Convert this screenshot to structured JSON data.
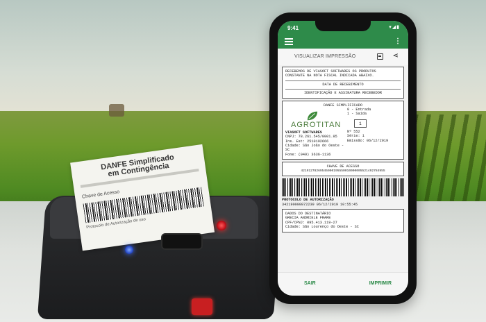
{
  "status_bar": {
    "time": "9:41",
    "icons": "▾◢▮"
  },
  "app": {
    "title": "VISUALIZAR IMPRESSÃO",
    "accent_color": "#2e8b4a",
    "icons": {
      "menu": "menu-icon",
      "more": "more-vert-icon",
      "print": "print-icon",
      "share": "share-icon"
    }
  },
  "receipt_doc": {
    "recebimento": {
      "line1": "RECEBEMOS DE VIASOFT SOFTWARES OS PRODUTOS",
      "line2": "CONSTANTE NA NOTA FISCAL INDICADA ABAIXO.",
      "date_label": "DATA DE RECEBIMENTO",
      "sign_label": "IDENTIFICAÇÃO E ASSINATURA RECEBEDOR"
    },
    "danfe": {
      "title": "DANFE SIMPLIFICADO",
      "brand": "AGROTITAN",
      "op_line1": "0 - Entrada",
      "op_line2": "1 - Saída",
      "op_value": "1",
      "number": "Nº 552",
      "series": "Série: 1",
      "emission": "Emissão: 06/12/2019",
      "company": "VIASOFT SOFTWARES",
      "cnpj": "CNPJ: 78.261.545/0001.95",
      "ie": "Ins. Est: 2510192666",
      "city": "Cidade: São João do Oeste - SC",
      "phone": "Fone: (049) 3636-1136"
    },
    "access_key": {
      "label": "CHAVE DE ACESSO",
      "value": "42191278269545000195550010000005521492784955"
    },
    "authorization": {
      "label": "PROTOCOLO DE AUTORIZAÇÃO",
      "value": "342190000872239 06/12/2019 10:55:45"
    },
    "recipient": {
      "label": "DADOS DO DESTINATÁRIO",
      "name": "GRECIA ANDRIELE FRARE",
      "cpf": "CPF/CPNJ: 095.413.119-27",
      "city": "Cidade: São Lourenço do Oeste - SC"
    }
  },
  "actions": {
    "exit": "SAIR",
    "print": "IMPRIMIR"
  },
  "printed_paper": {
    "title_line1": "DANFE Simplificado",
    "title_line2": "em Contingência",
    "key_label": "Chave de Acesso",
    "footer": "Protocolo de Autorização de uso"
  },
  "colors": {
    "printer_led_red": "#ff2a2a",
    "printer_led_blue": "#3f6dff",
    "field_green": "#4f8a22"
  }
}
